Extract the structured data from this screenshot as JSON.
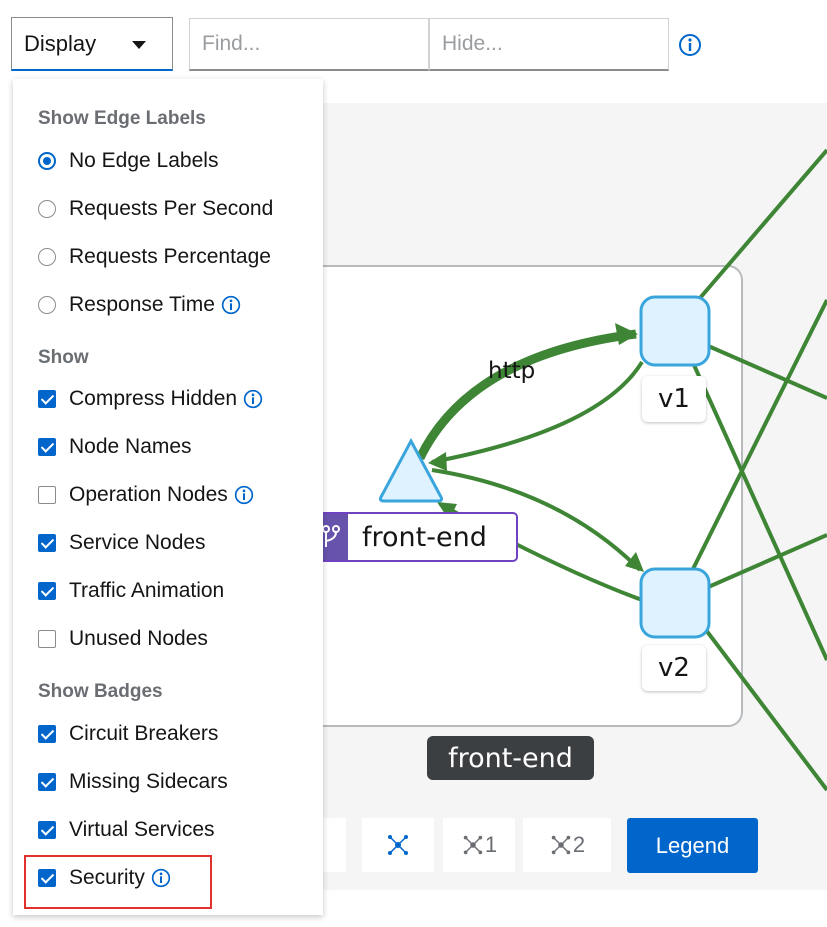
{
  "toolbar": {
    "display_label": "Display",
    "find_placeholder": "Find...",
    "hide_placeholder": "Hide..."
  },
  "menu": {
    "edge_labels_heading": "Show Edge Labels",
    "edge_labels": [
      {
        "label": "No Edge Labels",
        "selected": true
      },
      {
        "label": "Requests Per Second",
        "selected": false
      },
      {
        "label": "Requests Percentage",
        "selected": false
      },
      {
        "label": "Response Time",
        "selected": false
      }
    ],
    "show_heading": "Show",
    "show_items": [
      {
        "label": "Compress Hidden",
        "checked": true
      },
      {
        "label": "Node Names",
        "checked": true
      },
      {
        "label": "Operation Nodes",
        "checked": false
      },
      {
        "label": "Service Nodes",
        "checked": true
      },
      {
        "label": "Traffic Animation",
        "checked": true
      },
      {
        "label": "Unused Nodes",
        "checked": false
      }
    ],
    "badges_heading": "Show Badges",
    "badge_items": [
      {
        "label": "Circuit Breakers",
        "checked": true
      },
      {
        "label": "Missing Sidecars",
        "checked": true
      },
      {
        "label": "Virtual Services",
        "checked": true
      },
      {
        "label": "Security",
        "checked": true
      }
    ]
  },
  "graph": {
    "edge_label": "http",
    "frontend_node_label": "front-end",
    "v1_label": "v1",
    "v2_label": "v2",
    "box_label": "front-end",
    "edge_color": "#3e8635",
    "node_fill": "#def3ff",
    "node_stroke": "#39a5dc"
  },
  "bottom_toolbar": {
    "layout1_label": "1",
    "layout2_label": "2",
    "legend_label": "Legend"
  }
}
